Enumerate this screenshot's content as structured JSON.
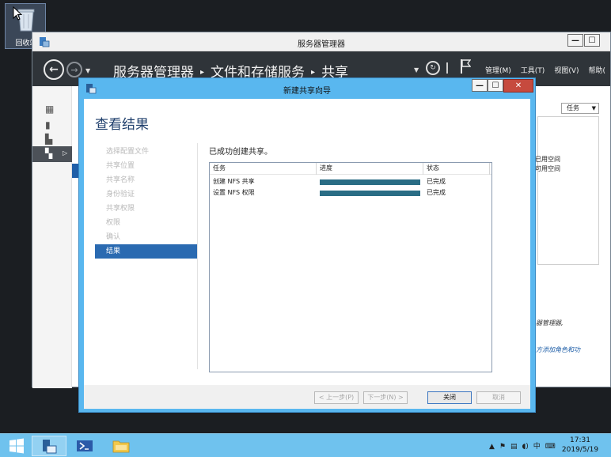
{
  "desktop": {
    "recycle_bin_label": "回收站"
  },
  "server_manager": {
    "title": "服务器管理器",
    "breadcrumb": [
      "服务器管理器",
      "文件和存储服务",
      "共享"
    ],
    "menus": [
      "管理(M)",
      "工具(T)",
      "视图(V)",
      "帮助("
    ],
    "tasks_label": "任务",
    "right_panel_lines": [
      "已用空间",
      "可用空间"
    ],
    "right_lower_lines": [
      "器管理器,",
      "方添加角色和功"
    ],
    "window_buttons": [
      "—",
      "☐"
    ]
  },
  "wizard": {
    "title": "新建共享向导",
    "heading": "查看结果",
    "steps": [
      {
        "label": "选择配置文件",
        "active": false
      },
      {
        "label": "共享位置",
        "active": false
      },
      {
        "label": "共享名称",
        "active": false
      },
      {
        "label": "身份验证",
        "active": false
      },
      {
        "label": "共享权限",
        "active": false
      },
      {
        "label": "权限",
        "active": false
      },
      {
        "label": "确认",
        "active": false
      },
      {
        "label": "结果",
        "active": true
      }
    ],
    "status_message": "已成功创建共享。",
    "table": {
      "columns": [
        "任务",
        "进度",
        "状态"
      ],
      "rows": [
        {
          "task": "创建 NFS 共享",
          "progress": 1.0,
          "status": "已完成"
        },
        {
          "task": "设置 NFS 权限",
          "progress": 1.0,
          "status": "已完成"
        }
      ]
    },
    "buttons": {
      "prev": "< 上一步(P)",
      "next": "下一步(N) >",
      "close": "关闭",
      "cancel": "取消"
    },
    "window_buttons": [
      "—",
      "☐",
      "✕"
    ]
  },
  "taskbar": {
    "time": "17:31",
    "date": "2019/5/19",
    "ime": "中"
  },
  "colors": {
    "wizard_frame": "#59b7ef",
    "header_dark": "#2f3439",
    "active_step": "#2a6ab1",
    "progress_fill": "#2a6d85",
    "taskbar": "#6fc2ee"
  }
}
